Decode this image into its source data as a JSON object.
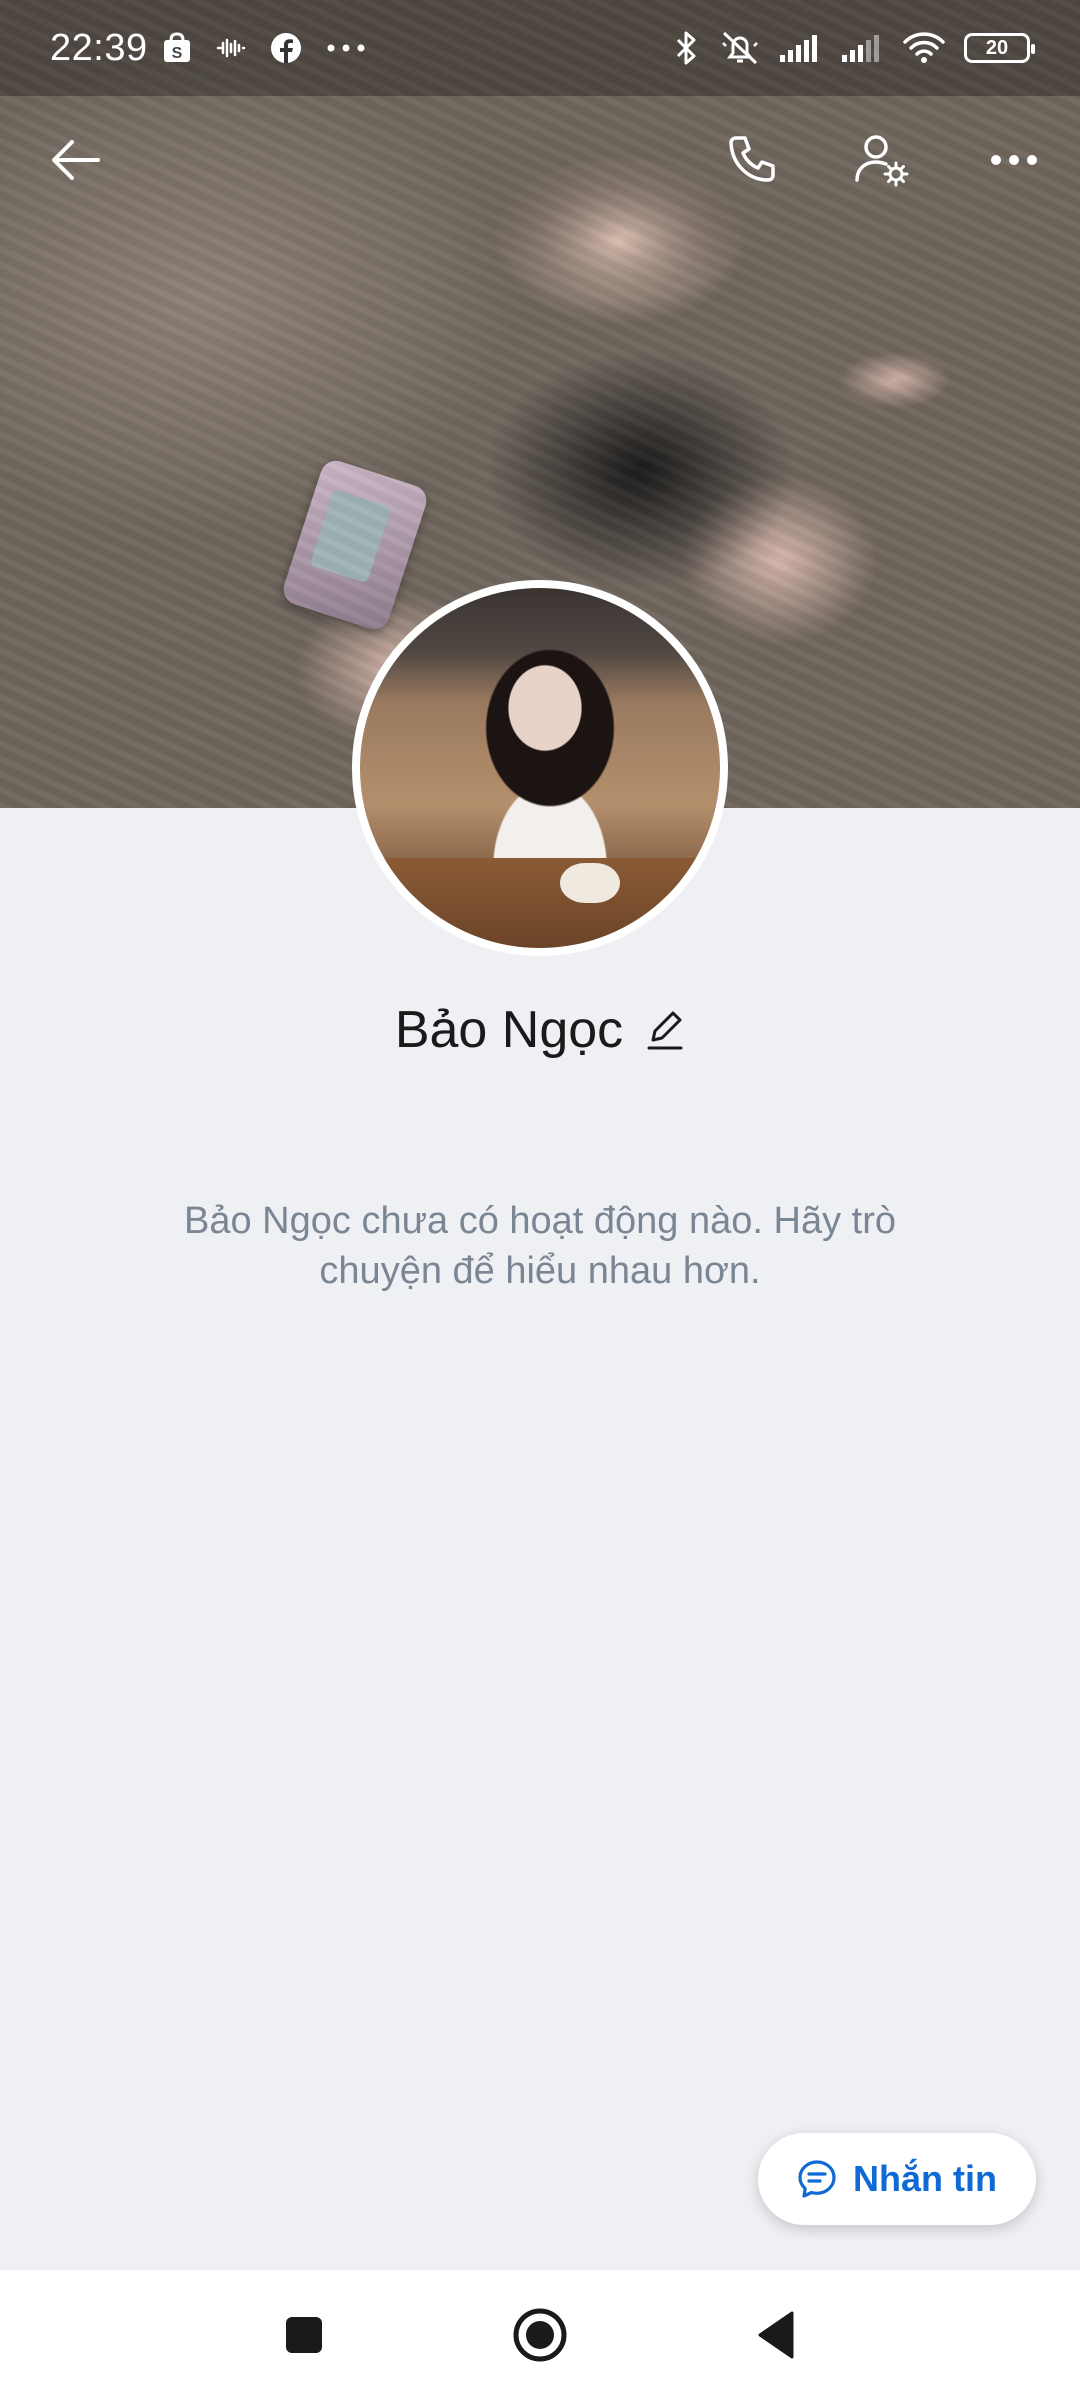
{
  "status_bar": {
    "time": "22:39",
    "battery": "20",
    "left_icons": [
      "shopee-icon",
      "voicemail-icon",
      "facebook-icon",
      "more-dots-icon"
    ],
    "right_icons": [
      "bluetooth-icon",
      "muted-bell-icon",
      "signal-icon",
      "signal-icon",
      "wifi-icon",
      "battery-icon"
    ]
  },
  "top_bar": {
    "icons": [
      "back-arrow-icon",
      "phone-icon",
      "user-settings-icon",
      "more-icon"
    ]
  },
  "profile": {
    "name": "Bảo Ngọc",
    "empty_message": "Bảo Ngọc chưa có hoạt động nào. Hãy trò chuyện để hiểu nhau hơn."
  },
  "fab": {
    "label": "Nhắn tin",
    "icon": "chat-bubble-icon",
    "color": "#0f6ad6"
  },
  "nav_bar": {
    "icons": [
      "recents-square-icon",
      "home-circle-icon",
      "back-triangle-icon"
    ]
  },
  "colors": {
    "background": "#eff0f4",
    "muted_text": "#7b8694",
    "accent": "#0f6ad6"
  }
}
